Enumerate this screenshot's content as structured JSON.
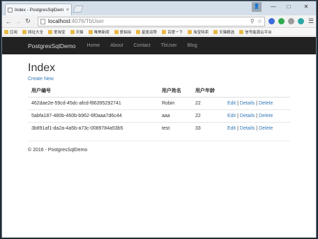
{
  "browser": {
    "tab_title": "Index - PostgresSqlDem",
    "tab_close": "×",
    "window_controls": {
      "minimize": "—",
      "maximize": "□",
      "close": "✕"
    },
    "url_host": "localhost",
    "url_path": ":4076/TbUser",
    "bookmarks": [
      "应用",
      "网址大全",
      "爱淘宝",
      "天猫",
      "唯美新闻",
      "爱拍拍",
      "星座运势",
      "百度一下",
      "淘宝特卖",
      "天猫精选",
      "信号能源云平台"
    ]
  },
  "site": {
    "brand": "PostgresSqlDemo",
    "nav": [
      "Home",
      "About",
      "Contact",
      "TbUser",
      "Blog"
    ]
  },
  "main": {
    "title": "Index",
    "create_link": "Create New",
    "columns": [
      "用户编号",
      "用户姓名",
      "用户年龄",
      ""
    ],
    "rows": [
      {
        "id": "462dae2e-59cd-45dc-afcd-f86395292741",
        "name": "Robin",
        "age": "22"
      },
      {
        "id": "5abfa187-480b-460b-b962-6f0aaa7d6c44",
        "name": "aaa",
        "age": "22"
      },
      {
        "id": "3b891af1-da2a-4a5b-a73c-0089784a53b5",
        "name": "test",
        "age": "33"
      }
    ],
    "actions": {
      "edit": "Edit",
      "details": "Details",
      "delete": "Delete",
      "separator": "|"
    }
  },
  "footer": {
    "text": "© 2016 - PostgresSqlDemo"
  },
  "colors": {
    "navbar": "#222222",
    "link": "#337ab7",
    "brand_text": "#dcdcdc"
  }
}
